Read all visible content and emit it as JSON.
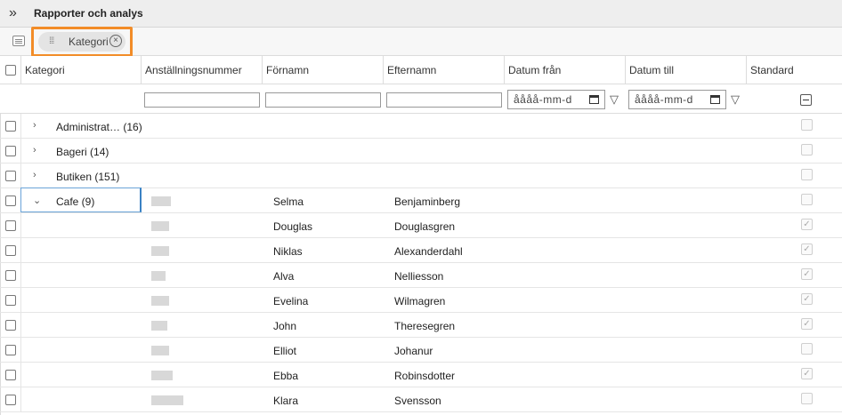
{
  "topbar": {
    "expand_glyph": "»",
    "title": "Rapporter och analys"
  },
  "groupbar": {
    "group_icon": "group-panel-icon",
    "chip_label": "Kategori",
    "chip_drag_glyph": "⁞⁞⁞",
    "chip_close_glyph": "×"
  },
  "columns": {
    "kategori": "Kategori",
    "anstallningsnummer": "Anställningsnummer",
    "fornamn": "Förnamn",
    "efternamn": "Efternamn",
    "datum_fran": "Datum från",
    "datum_till": "Datum till",
    "standard": "Standard"
  },
  "filters": {
    "datum_fran_placeholder": "åååå-mm-d",
    "datum_till_placeholder": "åååå-mm-d",
    "funnel_glyph": "▽"
  },
  "groups": [
    {
      "label": "Administrat… (16)",
      "chevron": "›"
    },
    {
      "label": "Bageri (14)",
      "chevron": "›"
    },
    {
      "label": "Butiken (151)",
      "chevron": "›"
    },
    {
      "label": "Cafe (9)",
      "chevron": "⌄"
    }
  ],
  "rows": [
    {
      "first": "Selma",
      "last": "Benjaminberg",
      "standard_checked": false
    },
    {
      "first": "Douglas",
      "last": "Douglasgren",
      "standard_checked": true
    },
    {
      "first": "Niklas",
      "last": "Alexanderdahl",
      "standard_checked": true
    },
    {
      "first": "Alva",
      "last": "Nelliesson",
      "standard_checked": true
    },
    {
      "first": "Evelina",
      "last": "Wilmagren",
      "standard_checked": true
    },
    {
      "first": "John",
      "last": "Theresegren",
      "standard_checked": true
    },
    {
      "first": "Elliot",
      "last": "Johanur",
      "standard_checked": false
    },
    {
      "first": "Ebba",
      "last": "Robinsdotter",
      "standard_checked": true
    },
    {
      "first": "Klara",
      "last": "Svensson",
      "standard_checked": false
    }
  ],
  "colors": {
    "highlight": "#f28c28",
    "focus": "#3b82c4"
  }
}
